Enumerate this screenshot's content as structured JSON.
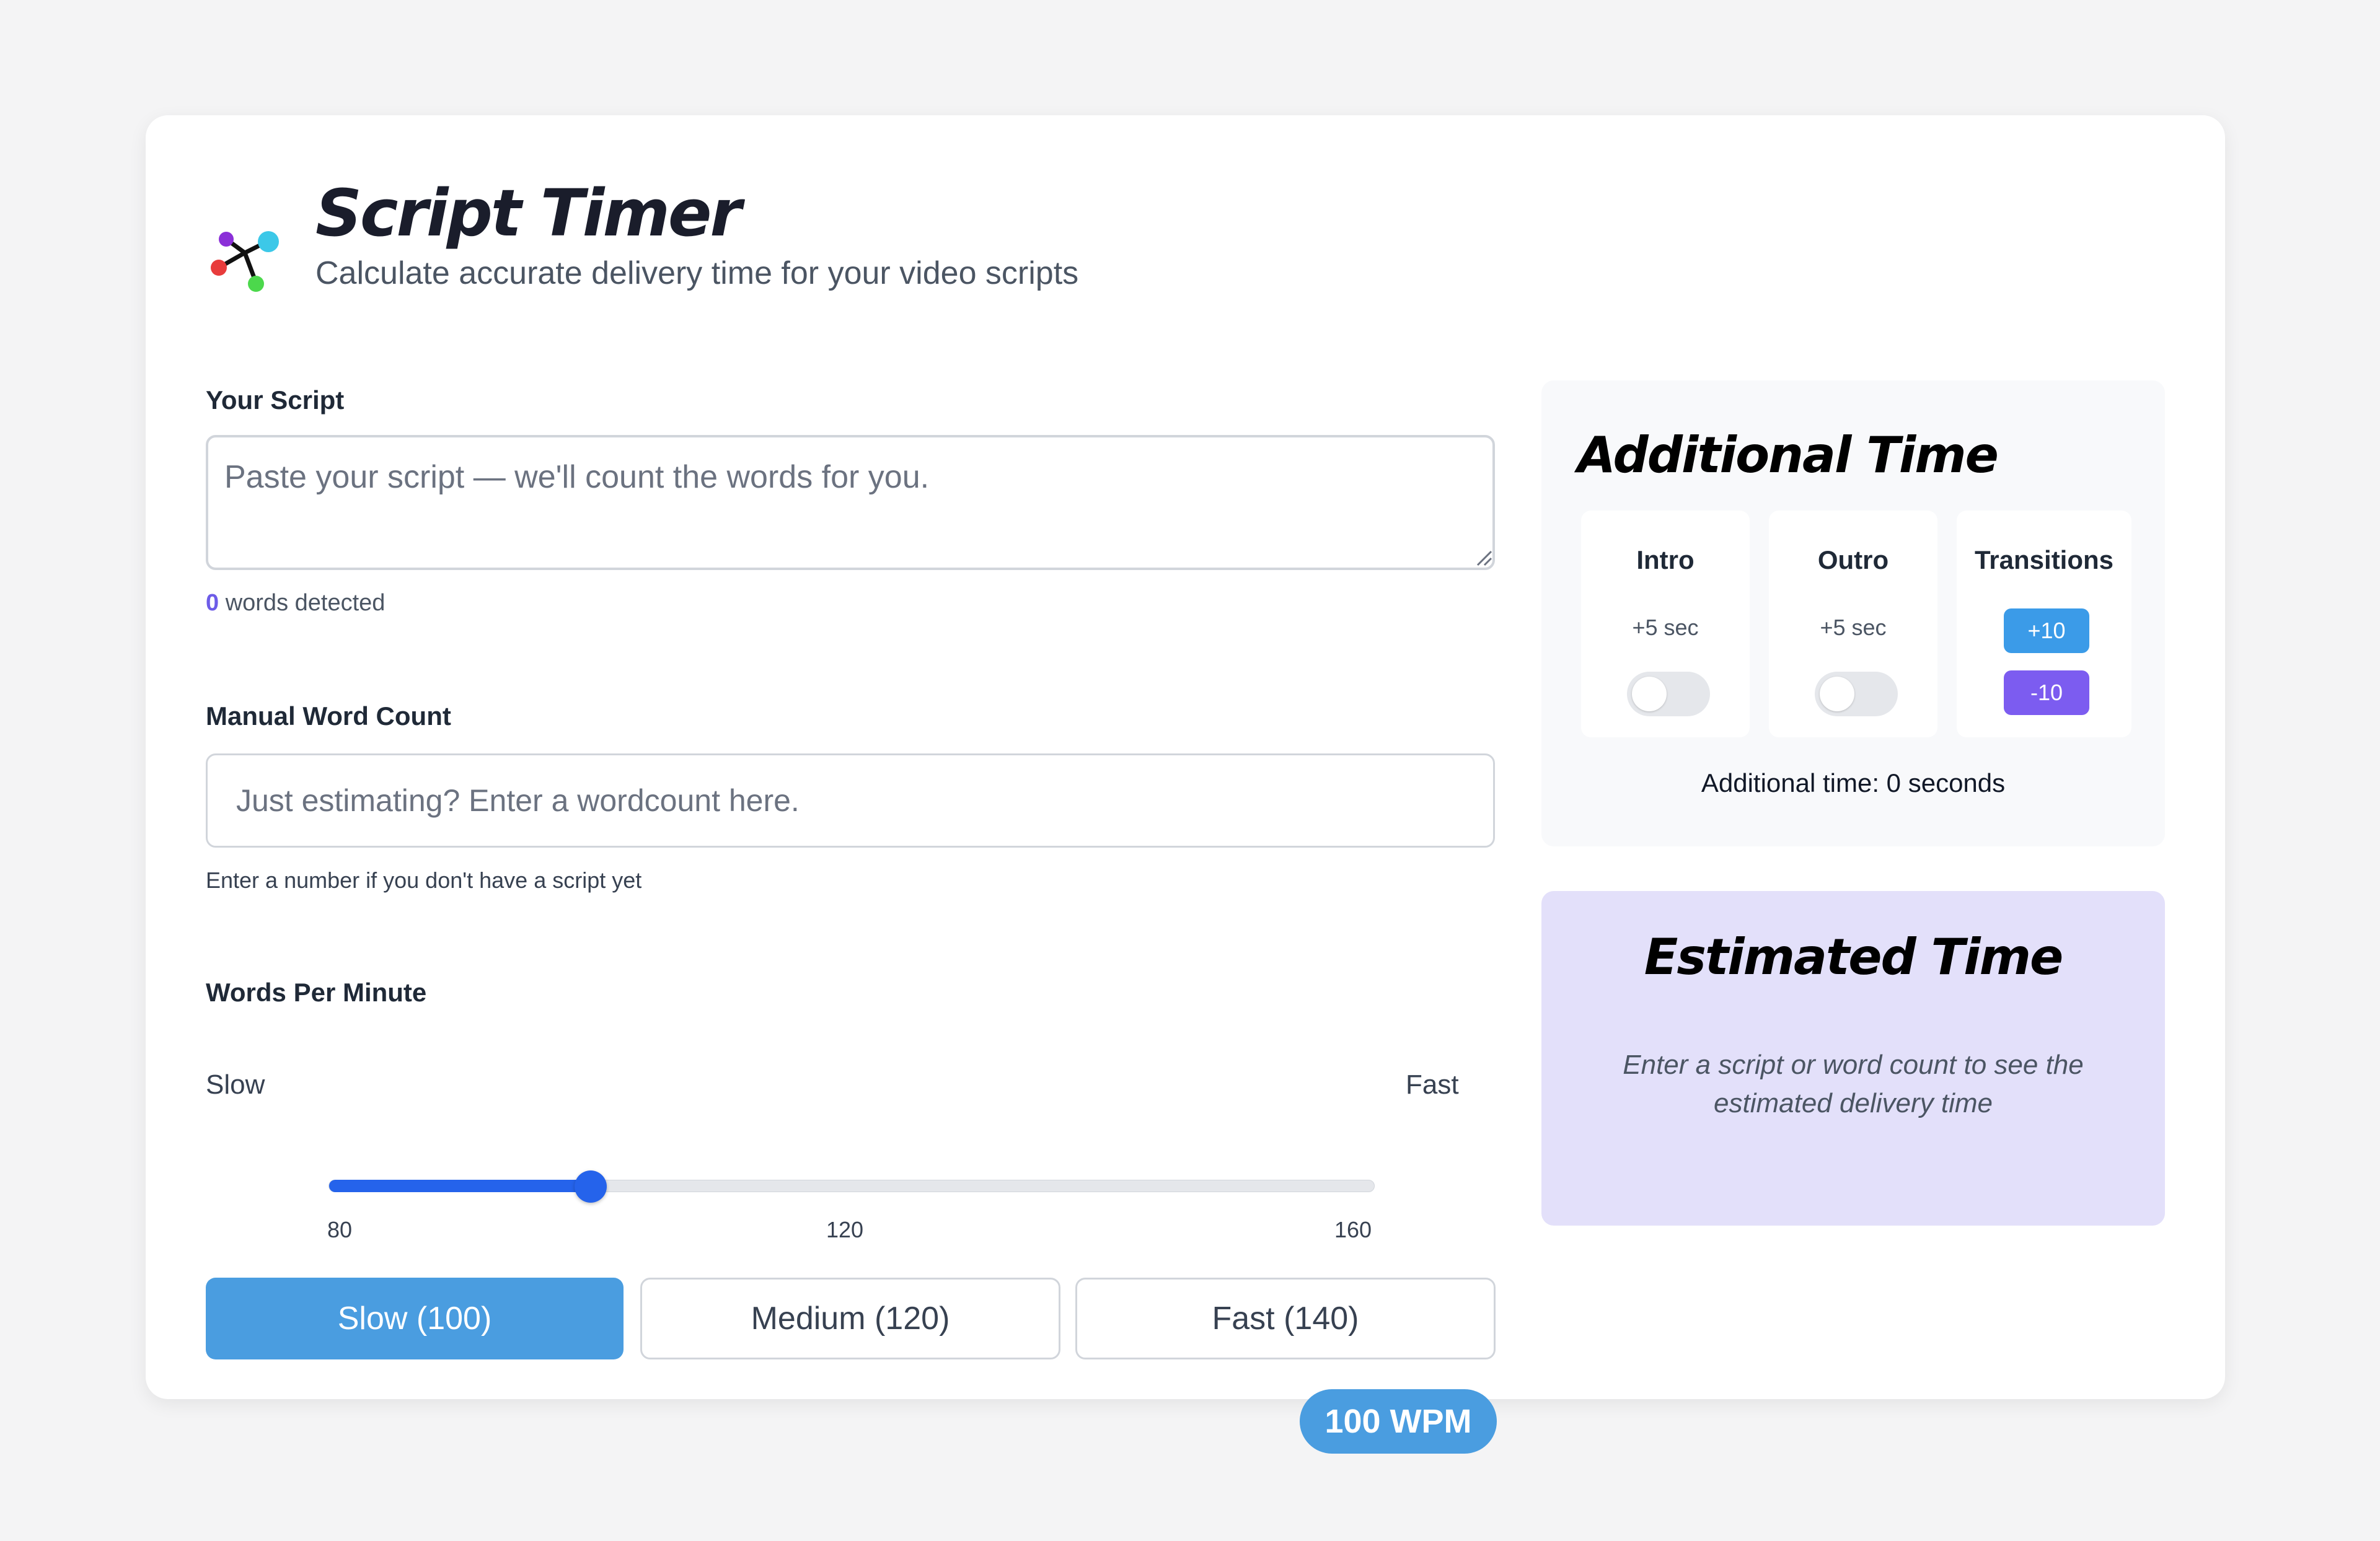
{
  "header": {
    "title": "Script Timer",
    "subtitle": "Calculate accurate delivery time for your video scripts",
    "logo_icon": "molecule-network-icon"
  },
  "script": {
    "label": "Your Script",
    "placeholder": "Paste your script — we'll count the words for you.",
    "value": "",
    "word_count": "0",
    "word_count_suffix": " words detected"
  },
  "manual": {
    "label": "Manual Word Count",
    "placeholder": "Just estimating? Enter a wordcount here.",
    "value": "",
    "help": "Enter a number if you don't have a script yet"
  },
  "wpm": {
    "label": "Words Per Minute",
    "slow_label": "Slow",
    "fast_label": "Fast",
    "min": 80,
    "max": 160,
    "value": 100,
    "ticks": [
      "80",
      "120",
      "160"
    ],
    "accent": "#2563eb",
    "presets": {
      "slow": "Slow (100)",
      "medium": "Medium (120)",
      "fast": "Fast (140)"
    },
    "badge": "100 WPM"
  },
  "additional": {
    "title": "Additional Time",
    "intro": {
      "label": "Intro",
      "sec": "+5 sec",
      "enabled": false
    },
    "outro": {
      "label": "Outro",
      "sec": "+5 sec",
      "enabled": false
    },
    "transitions": {
      "label": "Transitions",
      "plus": "+10",
      "minus": "-10"
    },
    "total": "Additional time: 0 seconds"
  },
  "estimate": {
    "title": "Estimated Time",
    "message": "Enter a script or word count to see the estimated delivery time",
    "background": "#e3e0fa"
  },
  "colors": {
    "primary_blue": "#4a9de0",
    "purple": "#7c5cf0"
  }
}
